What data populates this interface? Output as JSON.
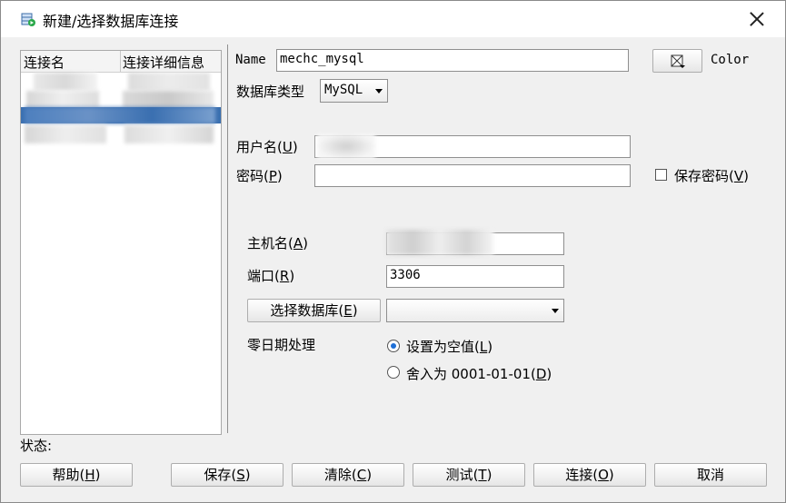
{
  "window": {
    "title": "新建/选择数据库连接"
  },
  "conn_list": {
    "col_name": "连接名",
    "col_detail": "连接详细信息"
  },
  "form": {
    "name_label": "Name",
    "name_value": "mechc_mysql",
    "color_label": "Color",
    "db_type_label": "数据库类型",
    "db_type_value": "MySQL",
    "username_label": "用户名",
    "username_key": "U",
    "password_label": "密码",
    "password_key": "P",
    "save_password_label": "保存密码",
    "save_password_key": "V",
    "save_password_checked": false,
    "host_label": "主机名",
    "host_key": "A",
    "port_label": "端口",
    "port_key": "R",
    "port_value": "3306",
    "choose_db_label": "选择数据库",
    "choose_db_key": "E",
    "zero_date_label": "零日期处理",
    "zero_opt1_label": "设置为空值",
    "zero_opt1_key": "L",
    "zero_opt2_label": "舍入为 0001-01-01",
    "zero_opt2_key": "D",
    "zero_selected": "设置为空值"
  },
  "status": {
    "label": "状态:"
  },
  "buttons": {
    "help": "帮助",
    "help_key": "H",
    "save": "保存",
    "save_key": "S",
    "clear": "清除",
    "clear_key": "C",
    "test": "测试",
    "test_key": "T",
    "connect": "连接",
    "connect_key": "O",
    "cancel": "取消"
  },
  "colors": {
    "selection": "#3a6fb0",
    "radio_dot": "#1f6fd6"
  },
  "icons": {
    "app": "database-connection-icon",
    "color": "color-picker-icon",
    "close": "close-icon"
  }
}
